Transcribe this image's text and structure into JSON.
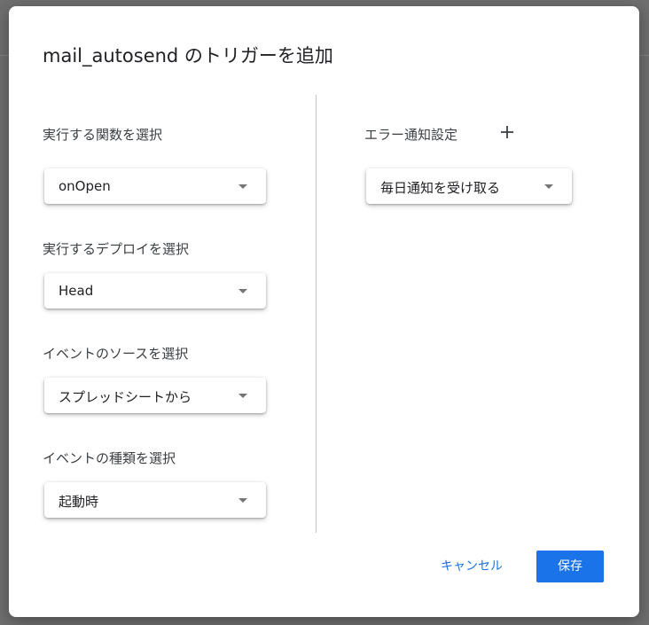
{
  "dialog": {
    "title": "mail_autosend のトリガーを追加"
  },
  "fields": {
    "function": {
      "label": "実行する関数を選択",
      "value": "onOpen"
    },
    "deployment": {
      "label": "実行するデプロイを選択",
      "value": "Head"
    },
    "event_source": {
      "label": "イベントのソースを選択",
      "value": "スプレッドシートから"
    },
    "event_type": {
      "label": "イベントの種類を選択",
      "value": "起動時"
    },
    "error_notification": {
      "label": "エラー通知設定",
      "value": "毎日通知を受け取る",
      "add_icon": "plus-icon"
    }
  },
  "actions": {
    "cancel_label": "キャンセル",
    "save_label": "保存"
  },
  "colors": {
    "accent": "#1a73e8",
    "overlay": "#6f6f6f",
    "dialog_bg": "#ffffff"
  },
  "icons": {
    "dropdown": "caret-down-icon",
    "add": "plus-icon"
  }
}
